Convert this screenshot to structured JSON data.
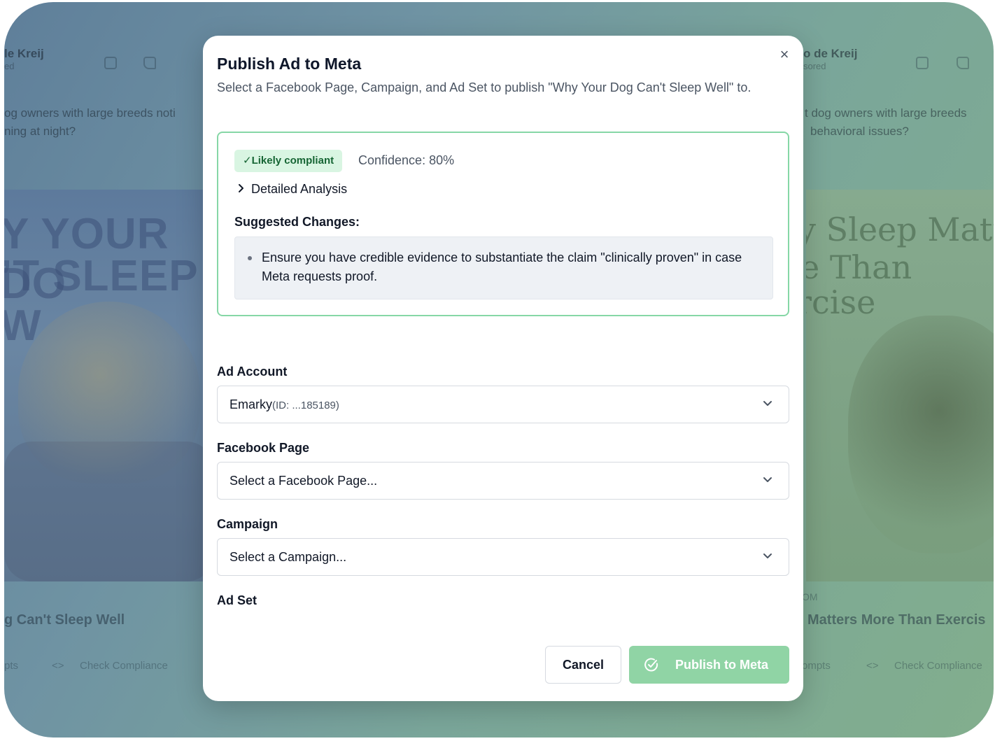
{
  "background": {
    "left_card": {
      "author": "le Kreij",
      "sponsored": "ed",
      "text_line1": "og owners with large breeds noti",
      "text_line2": "ning at night?",
      "hero_line1": "Y YOUR DO",
      "hero_line2": "’T SLEEP W",
      "ad_title": "g Can't Sleep Well",
      "footer_prompts": "pts",
      "footer_code_icon": "<>",
      "footer_compliance": "Check Compliance"
    },
    "right_card": {
      "author": "o de Kreij",
      "sponsored": "sored",
      "text_line1": "t dog owners with large breeds",
      "text_line2": "behavioral issues?",
      "hero_line1": "y Sleep Matter",
      "hero_line2": "e Than",
      "hero_line3": "rcise",
      "domain": "OM",
      "ad_title": "Matters More Than Exercis",
      "footer_prompts": "ompts",
      "footer_code_icon": "<>",
      "footer_compliance": "Check Compliance"
    }
  },
  "modal": {
    "title": "Publish Ad to Meta",
    "description": "Select a Facebook Page, Campaign, and Ad Set to publish \"Why Your Dog Can't Sleep Well\" to.",
    "close_icon": "×",
    "compliance": {
      "badge": "✓Likely compliant",
      "confidence": "Confidence: 80%",
      "detailed_analysis": "Detailed Analysis",
      "suggested_heading": "Suggested Changes:",
      "suggestions": [
        "Ensure you have credible evidence to substantiate the claim \"clinically proven\" in case Meta requests proof."
      ],
      "border_color": "#86d7a6"
    },
    "fields": {
      "ad_account": {
        "label": "Ad Account",
        "value": "Emarky",
        "id_text": "(ID: ...185189)"
      },
      "facebook_page": {
        "label": "Facebook Page",
        "placeholder": "Select a Facebook Page..."
      },
      "campaign": {
        "label": "Campaign",
        "placeholder": "Select a Campaign..."
      },
      "ad_set": {
        "label": "Ad Set"
      }
    },
    "buttons": {
      "cancel": "Cancel",
      "publish": "Publish to Meta",
      "publish_color": "#90d4a5"
    }
  }
}
